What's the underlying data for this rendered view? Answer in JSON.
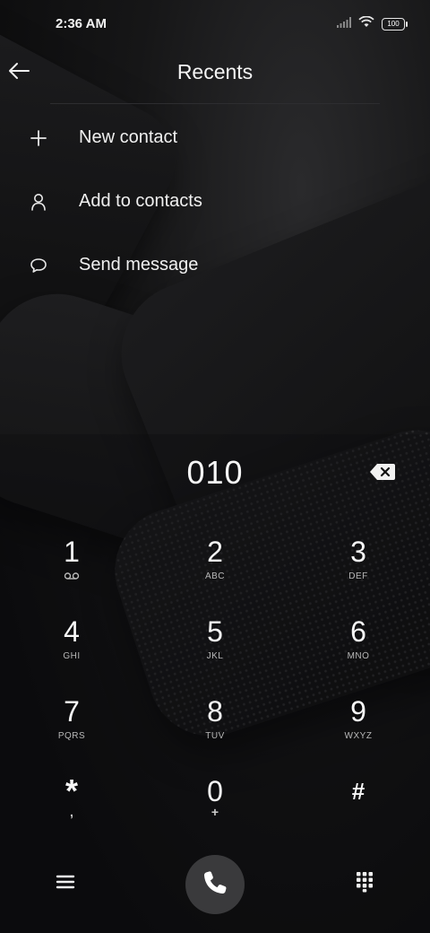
{
  "status_bar": {
    "time": "2:36 AM",
    "battery": "100",
    "icons": [
      "signal-icon",
      "wifi-icon",
      "battery-icon"
    ]
  },
  "header": {
    "title": "Recents",
    "back_icon": "arrow-left-icon"
  },
  "menu": {
    "items": [
      {
        "label": "New contact",
        "icon": "plus-icon"
      },
      {
        "label": "Add to contacts",
        "icon": "person-icon"
      },
      {
        "label": "Send message",
        "icon": "chat-bubble-icon"
      }
    ]
  },
  "dialer": {
    "number": "010",
    "backspace_icon": "backspace-icon",
    "keys": [
      {
        "digit": "1",
        "letters": "",
        "icon": "voicemail-icon"
      },
      {
        "digit": "2",
        "letters": "ABC"
      },
      {
        "digit": "3",
        "letters": "DEF"
      },
      {
        "digit": "4",
        "letters": "GHI"
      },
      {
        "digit": "5",
        "letters": "JKL"
      },
      {
        "digit": "6",
        "letters": "MNO"
      },
      {
        "digit": "7",
        "letters": "PQRS"
      },
      {
        "digit": "8",
        "letters": "TUV"
      },
      {
        "digit": "9",
        "letters": "WXYZ"
      },
      {
        "digit": "*",
        "letters": ","
      },
      {
        "digit": "0",
        "letters": "+"
      },
      {
        "digit": "#",
        "letters": ""
      }
    ]
  },
  "bottom_bar": {
    "menu_icon": "hamburger-menu-icon",
    "call_icon": "phone-icon",
    "dialpad_icon": "dialpad-icon"
  },
  "colors": {
    "background": "#0b0b0c",
    "text": "#ffffff",
    "call_button": "#3a3a3c"
  }
}
